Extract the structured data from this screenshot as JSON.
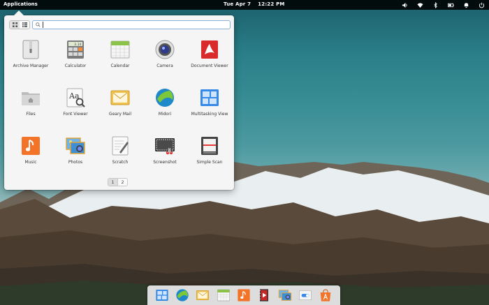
{
  "panel": {
    "applications_label": "Applications",
    "date": "Tue Apr  7",
    "time": "12:22 PM",
    "indicators": [
      "volume-icon",
      "wifi-icon",
      "bluetooth-icon",
      "battery-icon",
      "notifications-icon",
      "power-icon"
    ]
  },
  "launcher": {
    "search": {
      "value": "",
      "placeholder": ""
    },
    "view_modes": [
      "grid-view-icon",
      "category-view-icon"
    ],
    "apps": [
      {
        "label": "Archive Manager",
        "icon": "archive-manager-icon"
      },
      {
        "label": "Calculator",
        "icon": "calculator-icon"
      },
      {
        "label": "Calendar",
        "icon": "calendar-icon"
      },
      {
        "label": "Camera",
        "icon": "camera-icon"
      },
      {
        "label": "Document Viewer",
        "icon": "document-viewer-icon"
      },
      {
        "label": "Files",
        "icon": "files-icon"
      },
      {
        "label": "Font Viewer",
        "icon": "font-viewer-icon"
      },
      {
        "label": "Geary Mail",
        "icon": "geary-mail-icon"
      },
      {
        "label": "Midori",
        "icon": "midori-icon"
      },
      {
        "label": "Multitasking View",
        "icon": "multitasking-view-icon"
      },
      {
        "label": "Music",
        "icon": "music-icon"
      },
      {
        "label": "Photos",
        "icon": "photos-icon"
      },
      {
        "label": "Scratch",
        "icon": "scratch-icon"
      },
      {
        "label": "Screenshot",
        "icon": "screenshot-icon"
      },
      {
        "label": "Simple Scan",
        "icon": "simple-scan-icon"
      }
    ],
    "pages": [
      "1",
      "2"
    ],
    "active_page": "1",
    "calculator_display": "3.14"
  },
  "dock": {
    "items": [
      "multitasking-view-icon",
      "midori-icon",
      "geary-mail-icon",
      "calendar-icon",
      "music-icon",
      "videos-icon",
      "photos-icon",
      "settings-icon",
      "appcenter-icon"
    ]
  },
  "colors": {
    "panel_bg": "#000000",
    "accent_blue": "#3689e6",
    "search_border": "#8ab0d6"
  }
}
